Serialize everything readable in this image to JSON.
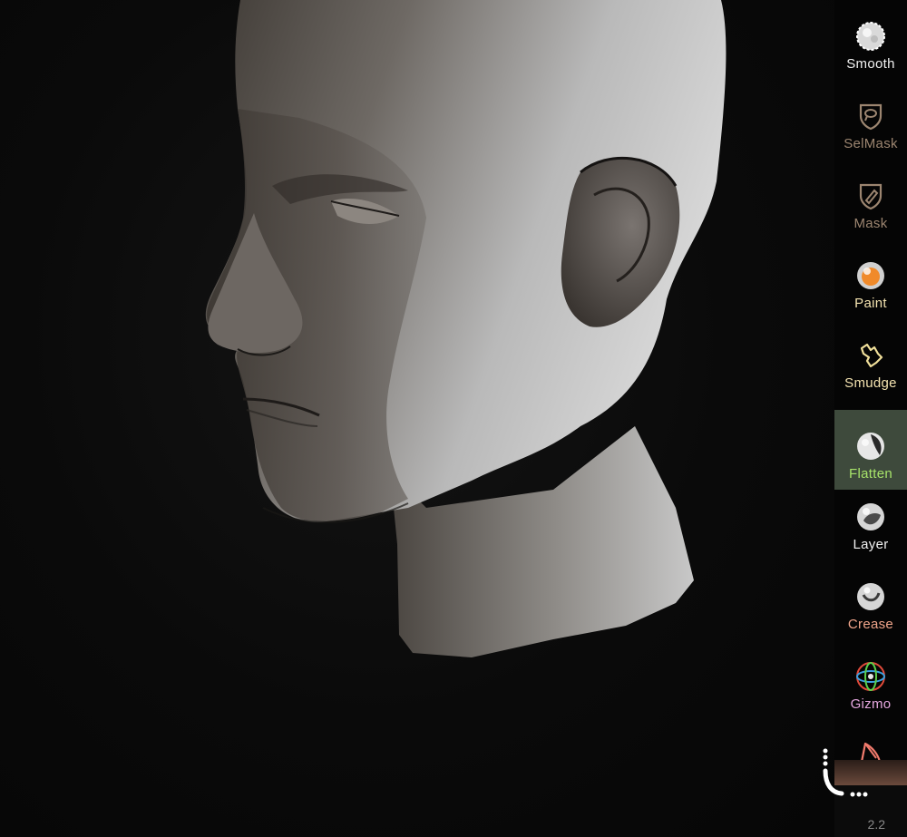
{
  "tools": [
    {
      "id": "smooth",
      "label": "Smooth",
      "color": "#f2f2f2",
      "icon": "smooth-brush-icon",
      "active": false
    },
    {
      "id": "selmask",
      "label": "SelMask",
      "color": "#9c8570",
      "icon": "selection-mask-icon",
      "active": false
    },
    {
      "id": "mask",
      "label": "Mask",
      "color": "#9c8570",
      "icon": "mask-brush-icon",
      "active": false
    },
    {
      "id": "paint",
      "label": "Paint",
      "color": "#f4e3b0",
      "icon": "paint-sphere-icon",
      "active": false
    },
    {
      "id": "smudge",
      "label": "Smudge",
      "color": "#f4e3b0",
      "icon": "smudge-hand-icon",
      "active": false
    },
    {
      "id": "flatten",
      "label": "Flatten",
      "color": "#a7e36a",
      "icon": "flatten-sphere-icon",
      "active": true
    },
    {
      "id": "layer",
      "label": "Layer",
      "color": "#f2f2f2",
      "icon": "layer-sphere-icon",
      "active": false
    },
    {
      "id": "crease",
      "label": "Crease",
      "color": "#f0a58a",
      "icon": "crease-sphere-icon",
      "active": false
    },
    {
      "id": "gizmo",
      "label": "Gizmo",
      "color": "#e6a8e0",
      "icon": "gizmo-axes-icon",
      "active": false
    },
    {
      "id": "eraser",
      "label": "",
      "color": "#f07a6c",
      "icon": "wedge-tool-icon",
      "active": false
    }
  ],
  "version": "2.2",
  "colors": {
    "active_bg": "#3e4a3c",
    "toolbar_bg": "#050505",
    "viewport_bg": "#0b0b0b"
  }
}
